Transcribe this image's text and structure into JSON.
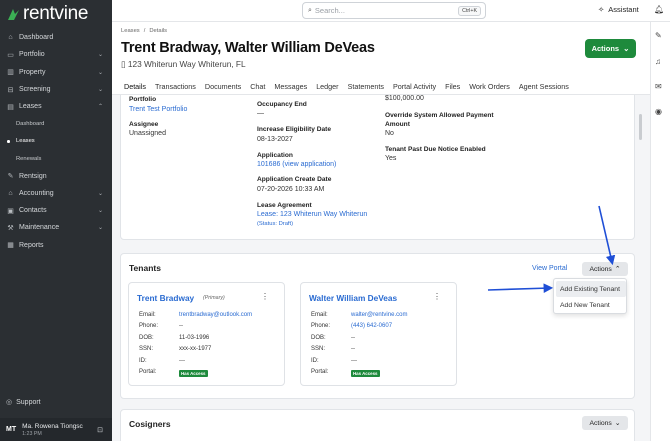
{
  "brand": {
    "name": "rentvine"
  },
  "sidebar": {
    "items": [
      {
        "label": "Dashboard",
        "icon": "dashboard-icon",
        "chevron": false
      },
      {
        "label": "Portfolio",
        "icon": "folder-icon",
        "chevron": true
      },
      {
        "label": "Property",
        "icon": "chart-icon",
        "chevron": true
      },
      {
        "label": "Screening",
        "icon": "filter-icon",
        "chevron": true
      },
      {
        "label": "Leases",
        "icon": "document-icon",
        "chevron": true,
        "expanded": true
      }
    ],
    "lease_sub": [
      {
        "label": "Dashboard"
      },
      {
        "label": "Leases",
        "active": true
      },
      {
        "label": "Renewals"
      }
    ],
    "items2": [
      {
        "label": "Rentsign",
        "icon": "pen-icon",
        "chevron": false
      },
      {
        "label": "Accounting",
        "icon": "bank-icon",
        "chevron": true
      },
      {
        "label": "Contacts",
        "icon": "contacts-icon",
        "chevron": true
      },
      {
        "label": "Maintenance",
        "icon": "wrench-icon",
        "chevron": true
      },
      {
        "label": "Reports",
        "icon": "reports-icon",
        "chevron": false
      }
    ],
    "support_label": "Support",
    "user": {
      "initials": "MT",
      "name": "Ma. Rowena Tiongsc",
      "time": "1:23 PM"
    }
  },
  "topbar": {
    "search_placeholder": "Search...",
    "shortcut": "Ctrl+K",
    "assistant_label": "Assistant"
  },
  "header": {
    "breadcrumb": [
      "Leases",
      "/",
      "Details"
    ],
    "title": "Trent Bradway, Walter William DeVeas",
    "address": "123 Whiterun Way Whiterun, FL",
    "actions_label": "Actions",
    "tabs": [
      "Details",
      "Transactions",
      "Documents",
      "Chat",
      "Messages",
      "Ledger",
      "Statements",
      "Portal Activity",
      "Files",
      "Work Orders",
      "Agent Sessions"
    ]
  },
  "details": {
    "portfolio_label": "Portfolio",
    "portfolio_value": "Trent Test Portfolio",
    "assignee_label": "Assignee",
    "assignee_value": "Unassigned",
    "occupancy_end_label": "Occupancy End",
    "occupancy_end_value": "—",
    "increase_label": "Increase Eligibility Date",
    "increase_value": "08-13-2027",
    "application_label": "Application",
    "application_value": "101686 (view application)",
    "app_create_label": "Application Create Date",
    "app_create_value": "07-20-2026 10:33 AM",
    "lease_agreement_label": "Lease Agreement",
    "lease_agreement_value": "Lease: 123 Whiterun Way Whiterun",
    "lease_agreement_status": "(Status: Draft)",
    "amount_value": "$100,000.00",
    "override_label_1": "Override System Allowed Payment",
    "override_label_2": "Amount",
    "override_value": "No",
    "past_due_label": "Tenant Past Due Notice Enabled",
    "past_due_value": "Yes"
  },
  "tenants": {
    "title": "Tenants",
    "view_portal": "View Portal",
    "actions_label": "Actions",
    "dropdown": [
      "Add Existing Tenant",
      "Add New Tenant"
    ],
    "cards": [
      {
        "name": "Trent Bradway",
        "primary": "(Primary)",
        "email_label": "Email:",
        "email": "trentbradway@outlook.com",
        "phone_label": "Phone:",
        "phone": "--",
        "dob_label": "DOB:",
        "dob": "11-03-1996",
        "ssn_label": "SSN:",
        "ssn": "xxx-xx-1977",
        "id_label": "ID:",
        "id": "---",
        "portal_label": "Portal:",
        "portal": "Has Access"
      },
      {
        "name": "Walter William DeVeas",
        "email_label": "Email:",
        "email": "walter@rentvine.com",
        "phone_label": "Phone:",
        "phone": "(443) 642-0607",
        "dob_label": "DOB:",
        "dob": "--",
        "ssn_label": "SSN:",
        "ssn": "--",
        "id_label": "ID:",
        "id": "---",
        "portal_label": "Portal:",
        "portal": "Has Access"
      }
    ]
  },
  "cosigners": {
    "title": "Cosigners",
    "actions_label": "Actions"
  },
  "colors": {
    "sidebar_bg": "#2b2f33",
    "accent_green": "#1e8a3c",
    "link_blue": "#2a6bd1",
    "annotation_arrow": "#1f4fd6"
  }
}
